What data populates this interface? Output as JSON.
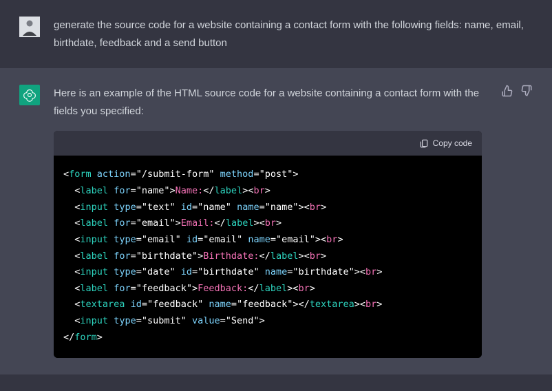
{
  "user": {
    "message": "generate the source code for a website containing a contact form with the following fields: name, email, birthdate, feedback and a send button"
  },
  "assistant": {
    "intro": "Here is an example of the HTML source code for a website containing a contact form with the fields you specified:",
    "copy_label": "Copy code",
    "code": {
      "form_open_tag": "form",
      "action_attr": "action",
      "action_val": "\"/submit-form\"",
      "method_attr": "method",
      "method_val": "\"post\"",
      "label_tag": "label",
      "for_attr": "for",
      "input_tag": "input",
      "type_attr": "type",
      "id_attr": "id",
      "name_attr": "name",
      "textarea_tag": "textarea",
      "value_attr": "value",
      "br_tag": "br",
      "form_close_tag": "form",
      "name_for": "\"name\"",
      "name_label": "Name:",
      "name_type": "\"text\"",
      "name_id": "\"name\"",
      "name_name": "\"name\"",
      "email_for": "\"email\"",
      "email_label": "Email:",
      "email_type": "\"email\"",
      "email_id": "\"email\"",
      "email_name": "\"email\"",
      "bd_for": "\"birthdate\"",
      "bd_label": "Birthdate:",
      "bd_type": "\"date\"",
      "bd_id": "\"birthdate\"",
      "bd_name": "\"birthdate\"",
      "fb_for": "\"feedback\"",
      "fb_label": "Feedback:",
      "fb_id": "\"feedback\"",
      "fb_name": "\"feedback\"",
      "submit_type": "\"submit\"",
      "submit_value": "\"Send\""
    }
  }
}
